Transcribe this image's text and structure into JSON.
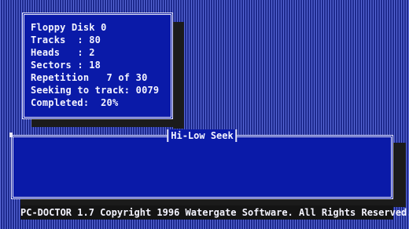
{
  "info_panel": {
    "lines": [
      "Floppy Disk 0",
      "Tracks  : 80",
      "Heads   : 2",
      "Sectors : 18",
      "Repetition   7 of 30",
      "Seeking to track: 0079",
      "Completed:  20%"
    ]
  },
  "seek_panel": {
    "title": "Hi-Low Seek"
  },
  "status_bar": {
    "text": "PC-DOCTOR 1.7 Copyright 1996 Watergate Software. All Rights Reserved."
  },
  "colors": {
    "panel_bg": "#0a1aa8",
    "desktop_dark": "#1e2a8e",
    "desktop_light": "#5a6ad8",
    "text": "#f4f4ff",
    "shadow": "#1b1b1b"
  }
}
